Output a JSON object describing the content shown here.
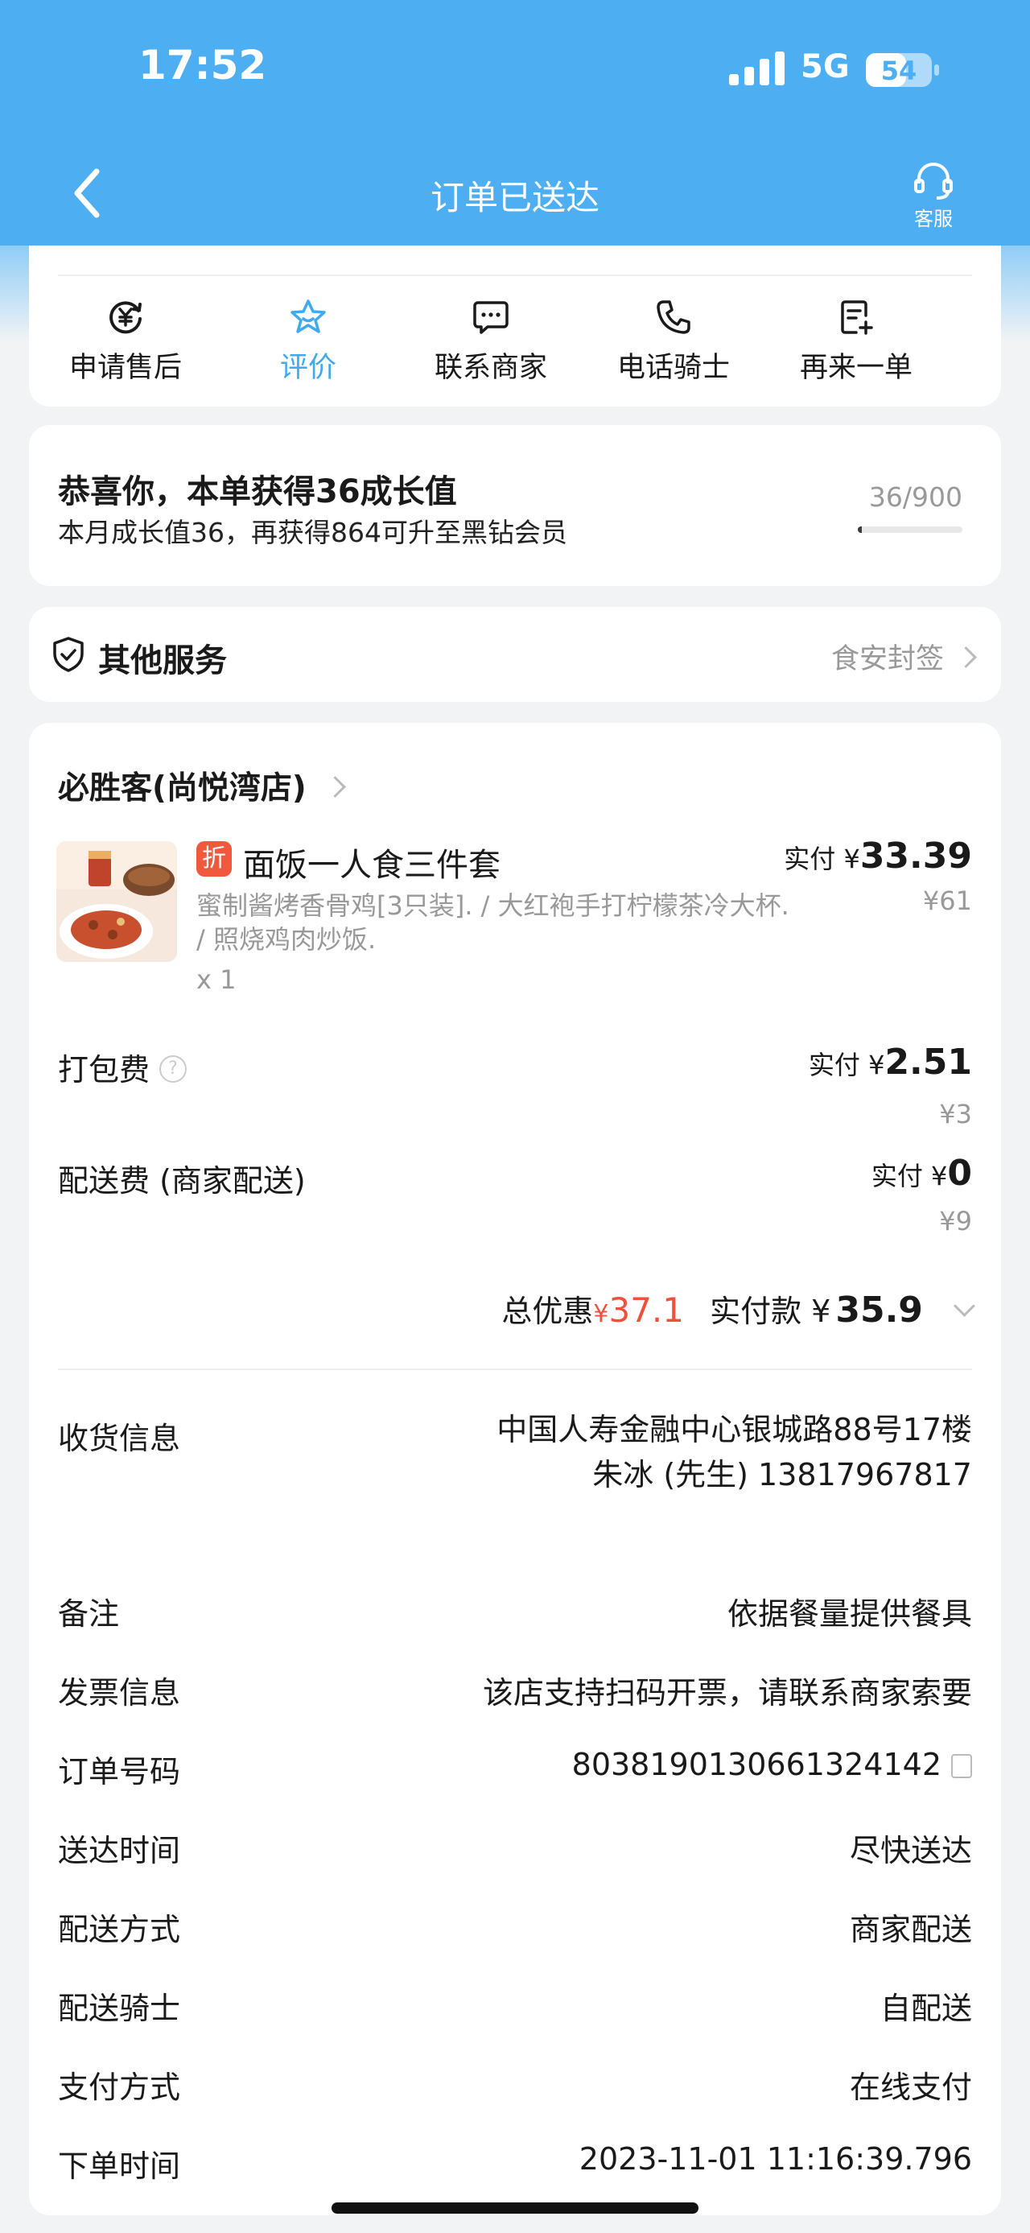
{
  "status_bar": {
    "time": "17:52",
    "network": "5G",
    "battery": "54"
  },
  "header": {
    "title": "订单已送达",
    "service_label": "客服"
  },
  "actions": [
    {
      "label": "申请售后",
      "icon": "after-sale-icon",
      "active": false
    },
    {
      "label": "评价",
      "icon": "star-icon",
      "active": true
    },
    {
      "label": "联系商家",
      "icon": "chat-icon",
      "active": false
    },
    {
      "label": "电话骑士",
      "icon": "phone-icon",
      "active": false
    },
    {
      "label": "再来一单",
      "icon": "reorder-icon",
      "active": false
    }
  ],
  "growth": {
    "title": "恭喜你，本单获得36成长值",
    "subtitle": "本月成长值36，再获得864可升至黑钻会员",
    "progress": "36/900",
    "progress_value": 36,
    "progress_max": 900
  },
  "other_services": {
    "title": "其他服务",
    "right": "食安封签"
  },
  "order": {
    "shop_name": "必胜客(尚悦湾店)",
    "item": {
      "tag": "折",
      "name": "面饭一人食三件套",
      "desc": "蜜制酱烤香骨鸡[3只装]. / 大红袍手打柠檬茶冷大杯. / 照烧鸡肉炒饭.",
      "qty": "x 1",
      "paid_label": "实付 ¥",
      "paid": "33.39",
      "original": "¥61"
    },
    "packing": {
      "label": "打包费",
      "paid_label": "实付 ¥",
      "paid": "2.51",
      "original": "¥3"
    },
    "delivery": {
      "label": "配送费 (商家配送)",
      "paid_label": "实付 ¥",
      "paid": "0",
      "original": "¥9"
    },
    "total": {
      "discount_label": "总优惠",
      "discount_currency": "¥",
      "discount": "37.1",
      "paid_label": "实付款 ¥",
      "paid": "35.9"
    },
    "info": {
      "receiver_label": "收货信息",
      "address": "中国人寿金融中心银城路88号17楼",
      "contact": "朱冰 (先生) 13817967817",
      "note_label": "备注",
      "note": "依据餐量提供餐具",
      "invoice_label": "发票信息",
      "invoice": "该店支持扫码开票，请联系商家索要",
      "order_no_label": "订单号码",
      "order_no": "8038190130661324142",
      "arrival_label": "送达时间",
      "arrival": "尽快送达",
      "method_label": "配送方式",
      "method": "商家配送",
      "rider_label": "配送骑士",
      "rider": "自配送",
      "pay_label": "支付方式",
      "pay": "在线支付",
      "time_label": "下单时间",
      "time": "2023-11-01 11:16:39.796"
    }
  },
  "colors": {
    "header": "#4eaef2",
    "accent": "#41a9ee",
    "discount": "#f0513a"
  }
}
